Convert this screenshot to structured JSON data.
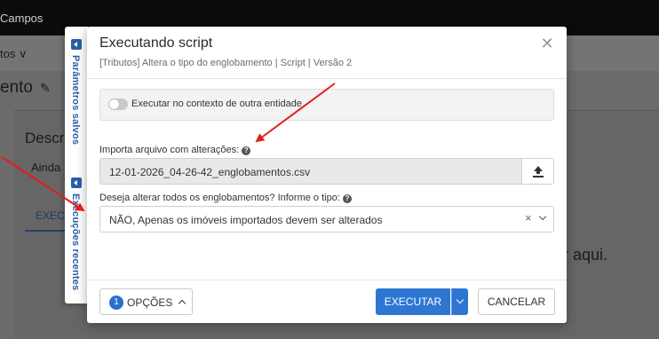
{
  "background": {
    "topbar_text": "Campos",
    "subnav_text": "tos ∨",
    "page_title": "ento",
    "section_title": "Descr",
    "ainda_text": "Ainda",
    "exec_tab": "EXEC",
    "aqui_text": "r aqui."
  },
  "side_tabs": {
    "saved_params": "Parâmetros salvos",
    "recent_runs": "Execuções recentes"
  },
  "modal": {
    "title": "Executando script",
    "subtitle": "[Tributos] Altera o tipo do englobamento | Script | Versão 2",
    "close_symbol": "✕",
    "toggle_label": "Executar no contexto de outra entidade",
    "toggle_on": false,
    "file_field": {
      "label": "Importa arquivo com alterações:",
      "value": "12-01-2026_04-26-42_englobamentos.csv"
    },
    "select_field": {
      "label": "Deseja alterar todos os englobamentos? Informe o tipo:",
      "value": "NÃO, Apenas os imóveis importados devem ser alterados",
      "clear_symbol": "×"
    },
    "footer": {
      "options_count": "1",
      "options_label": "OPÇÕES",
      "execute_label": "EXECUTAR",
      "cancel_label": "CANCELAR"
    }
  },
  "colors": {
    "primary": "#2f76d3",
    "side_tab_text": "#2a5ea6",
    "annotation_arrow": "#e41c1c"
  }
}
